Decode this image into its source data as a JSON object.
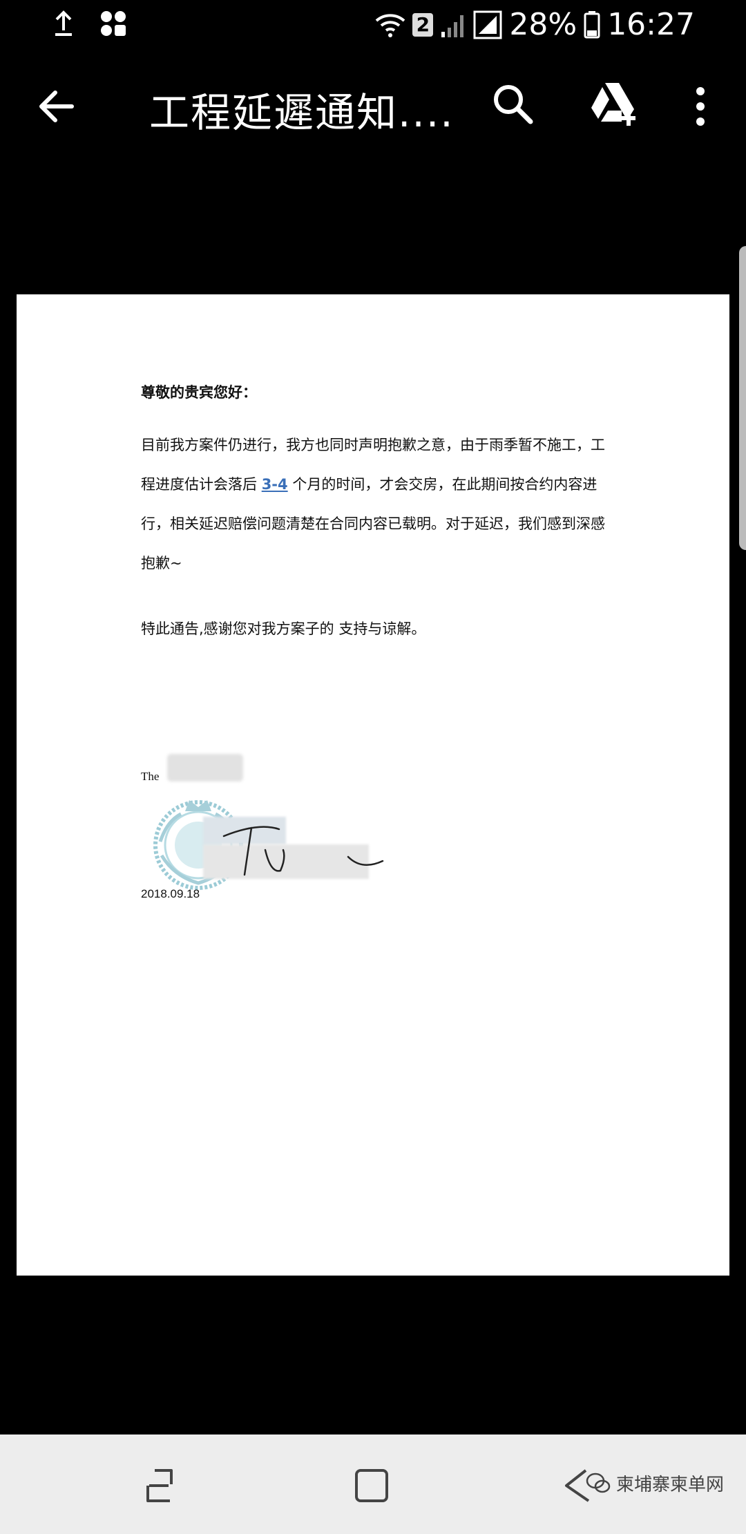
{
  "status_bar": {
    "sim_slot": "2",
    "battery": "28%",
    "time": "16:27"
  },
  "app_bar": {
    "title": "工程延遲通知....",
    "icons": [
      "back-arrow-icon",
      "search-icon",
      "drive-add-icon",
      "more-vert-icon"
    ]
  },
  "document": {
    "greeting": "尊敬的贵宾您好：",
    "paragraph": {
      "before": "目前我方案件仍进行，我方也同时声明抱歉之意，由于雨季暂不施工，工程进度估计会落后 ",
      "highlight": "3-4",
      "after": " 个月的时间，才会交房，在此期间按合约内容进行，相关延迟赔偿问题清楚在合同内容已载明。对于延迟，我们感到深感抱歉~"
    },
    "closing": "特此通告,感谢您对我方案子的  支持与谅解。",
    "signature_prefix": "The",
    "date": "2018.09.18"
  },
  "nav_bar": {
    "watermark": "柬埔寨柬单网",
    "icons": [
      "recent-apps-icon",
      "home-icon",
      "back-icon"
    ]
  },
  "colors": {
    "background": "#000000",
    "page": "#ffffff",
    "highlight": "#3a6fb8",
    "nav_bar": "#ededed"
  }
}
